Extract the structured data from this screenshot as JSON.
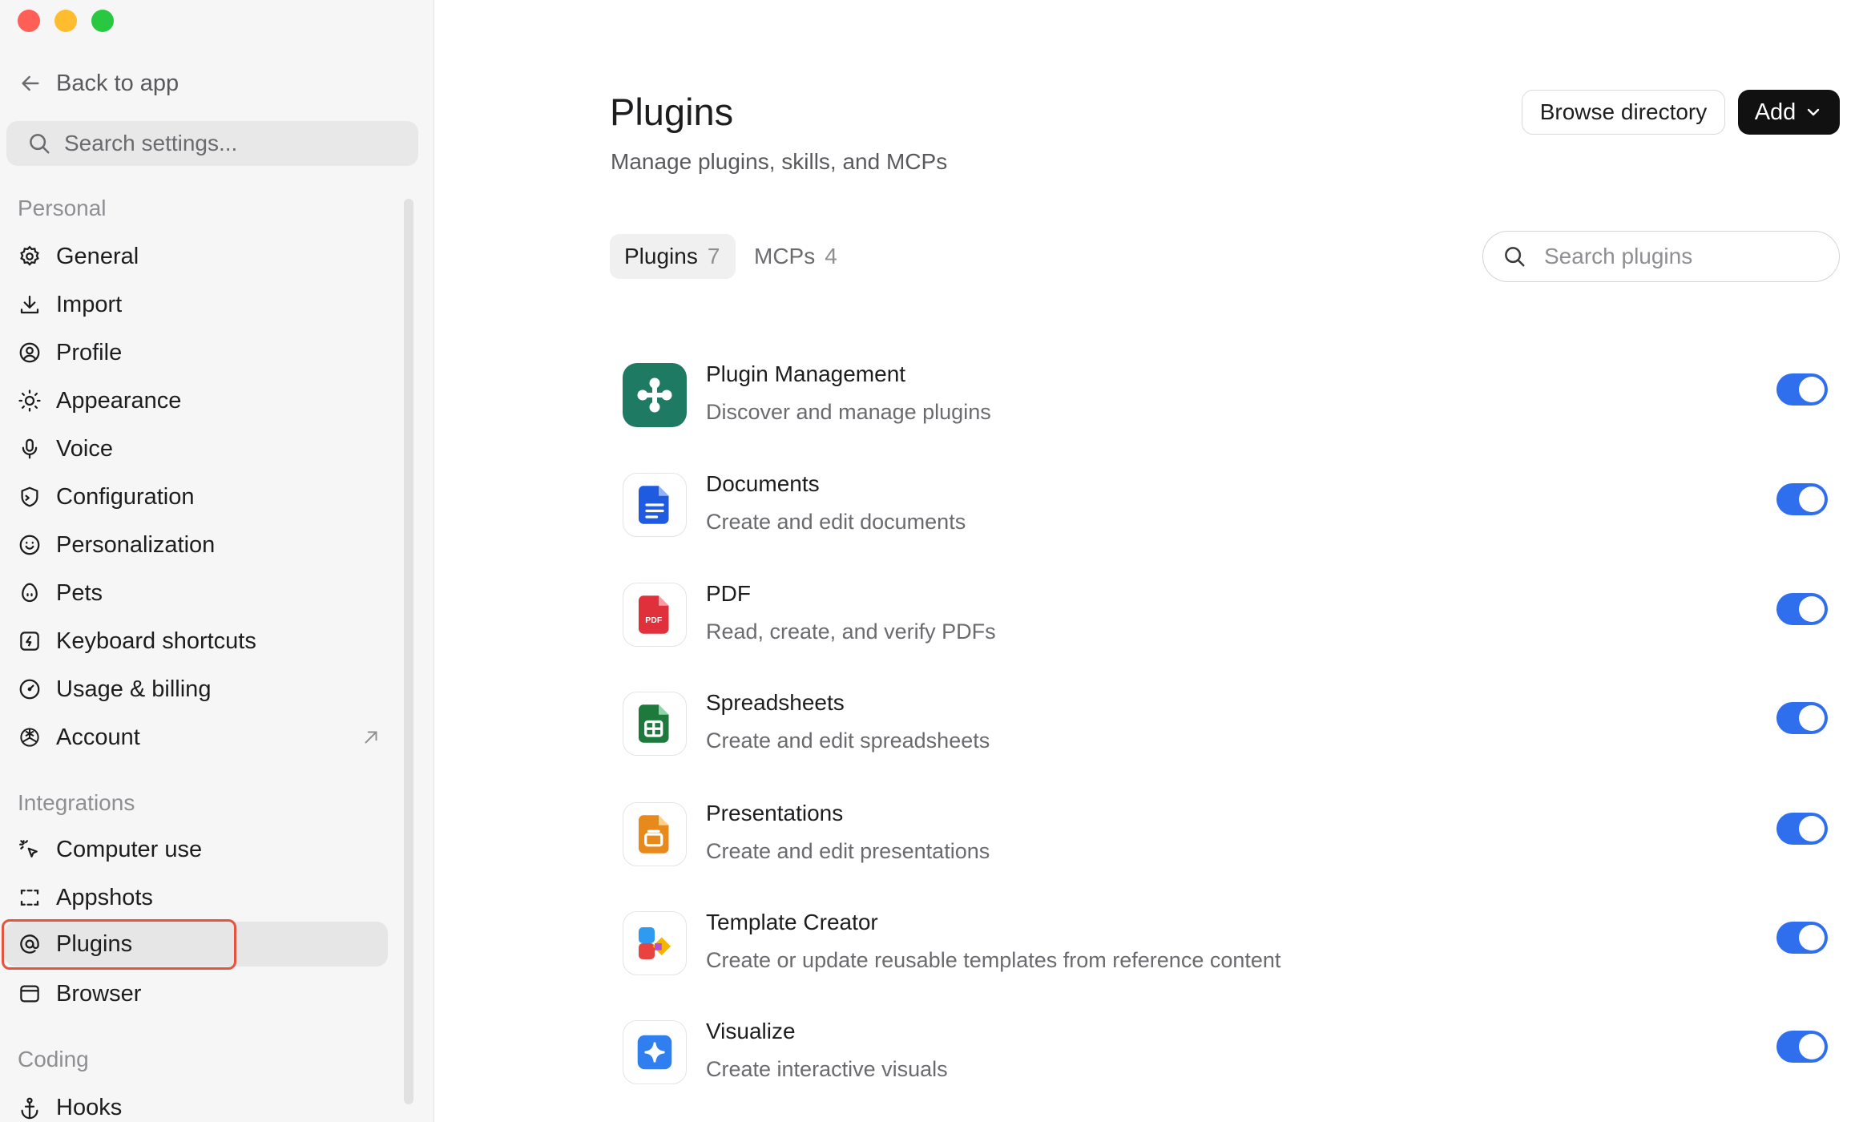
{
  "sidebar": {
    "back_label": "Back to app",
    "search_placeholder": "Search settings...",
    "sections": {
      "personal": "Personal",
      "integrations": "Integrations",
      "coding": "Coding"
    },
    "personal_items": [
      {
        "label": "General",
        "icon": "gear-icon"
      },
      {
        "label": "Import",
        "icon": "download-icon"
      },
      {
        "label": "Profile",
        "icon": "profile-icon"
      },
      {
        "label": "Appearance",
        "icon": "sun-icon"
      },
      {
        "label": "Voice",
        "icon": "microphone-icon"
      },
      {
        "label": "Configuration",
        "icon": "shield-icon"
      },
      {
        "label": "Personalization",
        "icon": "smile-icon"
      },
      {
        "label": "Pets",
        "icon": "egg-icon"
      },
      {
        "label": "Keyboard shortcuts",
        "icon": "lightning-icon"
      },
      {
        "label": "Usage & billing",
        "icon": "gauge-icon"
      },
      {
        "label": "Account",
        "icon": "openai-icon"
      }
    ],
    "integration_items": [
      {
        "label": "Computer use",
        "icon": "cursor-click-icon"
      },
      {
        "label": "Appshots",
        "icon": "screenshot-frame-icon"
      },
      {
        "label": "Plugins",
        "icon": "at-icon",
        "active": true
      },
      {
        "label": "Browser",
        "icon": "browser-window-icon"
      }
    ],
    "coding_items": [
      {
        "label": "Hooks",
        "icon": "anchor-icon"
      }
    ]
  },
  "main": {
    "title": "Plugins",
    "subtitle": "Manage plugins, skills, and MCPs",
    "browse_label": "Browse directory",
    "add_label": "Add",
    "tabs": [
      {
        "label": "Plugins",
        "count": "7",
        "active": true
      },
      {
        "label": "MCPs",
        "count": "4",
        "active": false
      }
    ],
    "search_placeholder": "Search plugins",
    "plugins": [
      {
        "name": "Plugin Management",
        "description": "Discover and manage plugins",
        "icon": "plugin-management-icon",
        "enabled": true
      },
      {
        "name": "Documents",
        "description": "Create and edit documents",
        "icon": "documents-icon",
        "enabled": true
      },
      {
        "name": "PDF",
        "description": "Read, create, and verify PDFs",
        "icon": "pdf-icon",
        "icon_text": "PDF",
        "enabled": true
      },
      {
        "name": "Spreadsheets",
        "description": "Create and edit spreadsheets",
        "icon": "spreadsheets-icon",
        "enabled": true
      },
      {
        "name": "Presentations",
        "description": "Create and edit presentations",
        "icon": "presentations-icon",
        "enabled": true
      },
      {
        "name": "Template Creator",
        "description": "Create or update reusable templates from reference content",
        "icon": "template-creator-icon",
        "enabled": true
      },
      {
        "name": "Visualize",
        "description": "Create interactive visuals",
        "icon": "visualize-icon",
        "enabled": true
      }
    ]
  },
  "colors": {
    "toggle_on": "#2f6fed",
    "highlight_box": "#e5533d",
    "add_button": "#111111"
  }
}
